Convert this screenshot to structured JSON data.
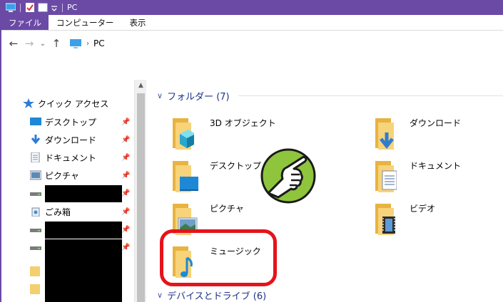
{
  "titlebar": {
    "title": "PC"
  },
  "ribbon": {
    "tabs": [
      "ファイル",
      "コンピューター",
      "表示"
    ]
  },
  "address": {
    "path": "PC"
  },
  "nav": {
    "quick_access": "クイック アクセス",
    "items": [
      "デスクトップ",
      "ダウンロード",
      "ドキュメント",
      "ピクチャ",
      "ごみ箱"
    ]
  },
  "content": {
    "group_folders": "フォルダー (7)",
    "group_devices": "デバイスとドライブ (6)",
    "folders": [
      "3D オブジェクト",
      "ダウンロード",
      "デスクトップ",
      "ドキュメント",
      "ピクチャ",
      "ビデオ",
      "ミュージック"
    ]
  },
  "icons": [
    "pc-icon",
    "properties-icon",
    "new-folder-icon",
    "dropdown-icon",
    "back-icon",
    "forward-icon",
    "recent-icon",
    "up-icon",
    "star-icon",
    "pin-icon",
    "pointing-hand-icon"
  ],
  "colors": {
    "accent": "#6b4aa6",
    "group_header": "#1e3287",
    "highlight": "#e5131b",
    "hand_badge": "#8fc43d"
  }
}
